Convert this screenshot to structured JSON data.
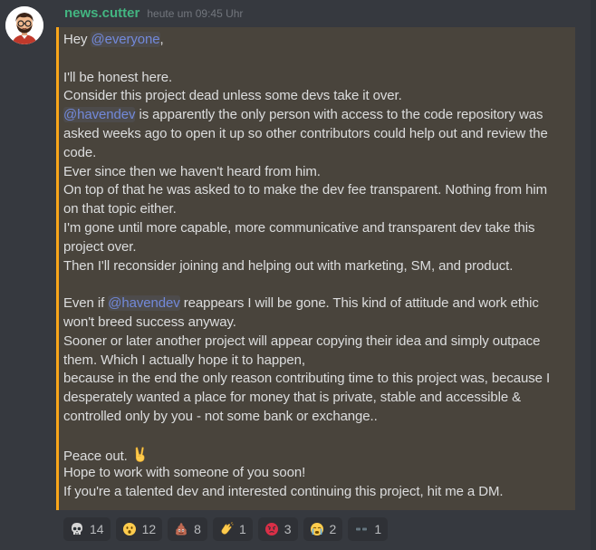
{
  "message": {
    "username": "news.cutter",
    "timestamp": "heute um 09:45 Uhr",
    "avatar": "avatar-man-icon",
    "accent_color": "#faa61a",
    "username_color": "#43b581",
    "mention_color": "#7289da",
    "lines": {
      "l1_pre": "Hey ",
      "l1_mention": "@everyone",
      "l1_post": ",",
      "l3": "I'll be honest here.",
      "l4": "Consider this project dead unless some devs take it over.",
      "l5_mention": "@havendev",
      "l5_post": " is apparently the only person with access to the code repository was",
      "l6": "asked weeks ago to open it up so other contributors could help out and review the",
      "l7": "code.",
      "l8": "Ever since then we haven't heard from him.",
      "l9": "On top of that he was asked to to make the dev fee transparent. Nothing from him",
      "l10": "on that topic either.",
      "l11": "I'm gone until more capable, more communicative and transparent dev take this",
      "l12": "project over.",
      "l13": "Then I'll reconsider joining and helping out with marketing, SM, and product.",
      "l15_pre": "Even if ",
      "l15_mention": "@havendev",
      "l15_post": " reappears I will be gone. This kind of attitude and work ethic",
      "l16": "won't breed success anyway.",
      "l17": "Sooner or later another project will appear copying their idea and simply outpace",
      "l18": "them. Which I actually hope it to happen,",
      "l19": "because in the end the only reason contributing time to this project was, because I",
      "l20": "desperately wanted a place for money that is private, stable and  accessible &",
      "l21": "controlled only by you - not some bank or exchange..",
      "l23": "Peace out.",
      "l23_emoji": "victory-hand-icon",
      "l24": "Hope to work with someone of you soon!",
      "l25": "If you're a talented dev and interested continuing this project, hit me a DM."
    }
  },
  "reactions": [
    {
      "icon": "skull-icon",
      "count": "14"
    },
    {
      "icon": "hushed-face-icon",
      "count": "12"
    },
    {
      "icon": "poop-icon",
      "count": "8"
    },
    {
      "icon": "clapping-hands-icon",
      "count": "1"
    },
    {
      "icon": "angry-face-icon",
      "count": "3"
    },
    {
      "icon": "crying-face-icon",
      "count": "2"
    },
    {
      "icon": "glasses-icon",
      "count": "1"
    }
  ]
}
